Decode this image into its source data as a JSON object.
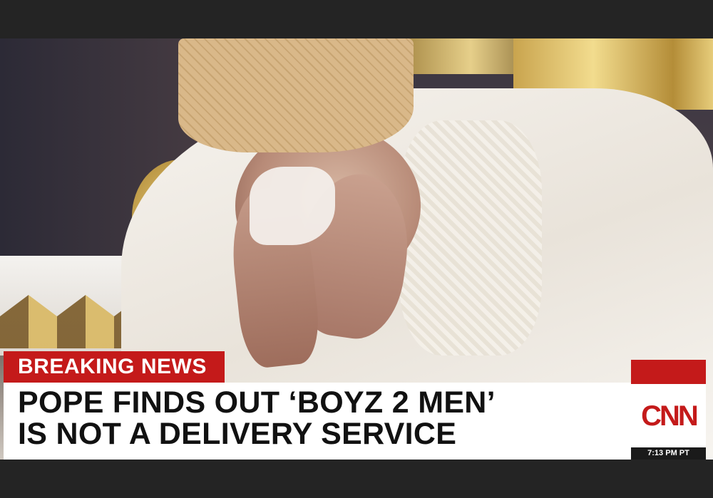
{
  "chyron": {
    "tag": "BREAKING NEWS",
    "headline_line1": "POPE FINDS OUT ‘BOYZ 2 MEN’",
    "headline_line2": "IS NOT A DELIVERY SERVICE"
  },
  "network": {
    "logo_text": "CNN",
    "time": "7:13 PM PT"
  },
  "colors": {
    "brand_red": "#c41a1a",
    "chyron_bg": "#ffffff",
    "frame": "#242424"
  }
}
